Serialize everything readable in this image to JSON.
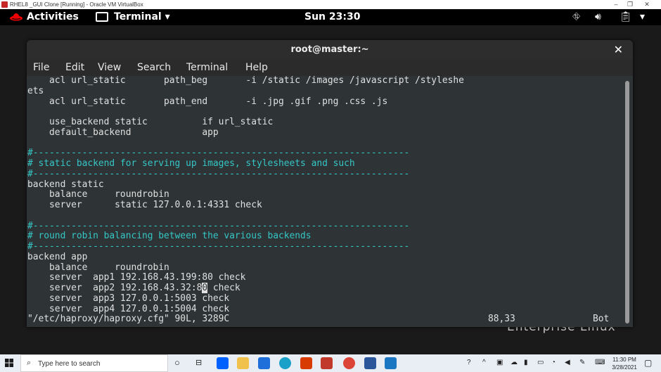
{
  "vbox": {
    "title": "RHEL8 _GUI Clone [Running] - Oracle VM VirtualBox"
  },
  "topbar": {
    "activities": "Activities",
    "app_menu": "Terminal ▾",
    "clock": "Sun 23:30"
  },
  "terminal": {
    "title": "root@master:~",
    "menu": [
      "File",
      "Edit",
      "View",
      "Search",
      "Terminal",
      "Help"
    ],
    "lines": [
      {
        "t": "    acl url_static       path_beg       -i /static /images /javascript /styleshe",
        "k": "n"
      },
      {
        "t": "ets",
        "k": "n"
      },
      {
        "t": "    acl url_static       path_end       -i .jpg .gif .png .css .js",
        "k": "n"
      },
      {
        "t": "",
        "k": "n"
      },
      {
        "t": "    use_backend static          if url_static",
        "k": "n"
      },
      {
        "t": "    default_backend             app",
        "k": "n"
      },
      {
        "t": "",
        "k": "n"
      },
      {
        "t": "#---------------------------------------------------------------------",
        "k": "c"
      },
      {
        "t": "# static backend for serving up images, stylesheets and such",
        "k": "c"
      },
      {
        "t": "#---------------------------------------------------------------------",
        "k": "c"
      },
      {
        "t": "backend static",
        "k": "n"
      },
      {
        "t": "    balance     roundrobin",
        "k": "n"
      },
      {
        "t": "    server      static 127.0.0.1:4331 check",
        "k": "n"
      },
      {
        "t": "",
        "k": "n"
      },
      {
        "t": "#---------------------------------------------------------------------",
        "k": "c"
      },
      {
        "t": "# round robin balancing between the various backends",
        "k": "c"
      },
      {
        "t": "#---------------------------------------------------------------------",
        "k": "c"
      },
      {
        "t": "backend app",
        "k": "n"
      },
      {
        "t": "    balance     roundrobin",
        "k": "n"
      },
      {
        "t": "    server  app1 192.168.43.199:80 check",
        "k": "n"
      },
      {
        "t": "    server  app2 192.168.43.32:8",
        "k": "n",
        "cursor": "0",
        "after": " check"
      },
      {
        "t": "    server  app3 127.0.0.1:5003 check",
        "k": "n"
      },
      {
        "t": "    server  app4 127.0.0.1:5004 check",
        "k": "n"
      }
    ],
    "status_file": "\"/etc/haproxy/haproxy.cfg\" 90L, 3289C",
    "status_pos": "88,33",
    "status_scroll": "Bot"
  },
  "desktop": {
    "brand": "Enterprise Linux"
  },
  "taskbar": {
    "search_placeholder": "Type here to search",
    "time": "11:30 PM",
    "date": "3/28/2021"
  },
  "colors": {
    "comment": "#35c6c6",
    "terminal_bg": "#2e3436",
    "foreground": "#e0e0e0"
  }
}
